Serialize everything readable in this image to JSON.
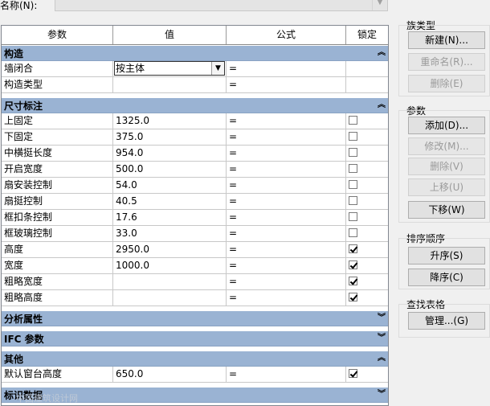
{
  "name_label": "名称(N):",
  "grid": {
    "columns": [
      "参数",
      "值",
      "公式",
      "锁定"
    ],
    "groups": [
      {
        "title": "构造",
        "expanded": true,
        "rows": [
          {
            "param": "墙闭合",
            "value": "按主体",
            "formula": "=",
            "locked": null,
            "editor": "dropdown"
          },
          {
            "param": "构造类型",
            "value": "",
            "formula": "=",
            "locked": null
          }
        ]
      },
      {
        "title": "尺寸标注",
        "expanded": true,
        "rows": [
          {
            "param": "上固定",
            "value": "1325.0",
            "formula": "=",
            "locked": false
          },
          {
            "param": "下固定",
            "value": "375.0",
            "formula": "=",
            "locked": false
          },
          {
            "param": "中横挺长度",
            "value": "954.0",
            "formula": "=",
            "locked": false
          },
          {
            "param": "开启宽度",
            "value": "500.0",
            "formula": "=",
            "locked": false
          },
          {
            "param": "扇安装控制",
            "value": "54.0",
            "formula": "=",
            "locked": false
          },
          {
            "param": "扇挺控制",
            "value": "40.5",
            "formula": "=",
            "locked": false
          },
          {
            "param": "框扣条控制",
            "value": "17.6",
            "formula": "=",
            "locked": false
          },
          {
            "param": "框玻璃控制",
            "value": "33.0",
            "formula": "=",
            "locked": false
          },
          {
            "param": "高度",
            "value": "2950.0",
            "formula": "=",
            "locked": true
          },
          {
            "param": "宽度",
            "value": "1000.0",
            "formula": "=",
            "locked": true
          },
          {
            "param": "粗略宽度",
            "value": "",
            "formula": "=",
            "locked": true
          },
          {
            "param": "粗略高度",
            "value": "",
            "formula": "=",
            "locked": true
          }
        ]
      },
      {
        "title": "分析属性",
        "expanded": false,
        "rows": []
      },
      {
        "title": "IFC 参数",
        "expanded": false,
        "rows": []
      },
      {
        "title": "其他",
        "expanded": true,
        "rows": [
          {
            "param": "默认窗台高度",
            "value": "650.0",
            "formula": "=",
            "locked": true
          }
        ]
      },
      {
        "title": "标识数据",
        "expanded": false,
        "rows": []
      }
    ]
  },
  "family_types": {
    "title": "族类型",
    "buttons": [
      {
        "label": "新建(N)...",
        "enabled": true
      },
      {
        "label": "重命名(R)...",
        "enabled": false
      },
      {
        "label": "删除(E)",
        "enabled": false
      }
    ]
  },
  "parameters": {
    "title": "参数",
    "buttons": [
      {
        "label": "添加(D)...",
        "enabled": true
      },
      {
        "label": "修改(M)...",
        "enabled": false
      },
      {
        "label": "删除(V)",
        "enabled": false
      },
      {
        "label": "上移(U)",
        "enabled": false
      },
      {
        "label": "下移(W)",
        "enabled": true
      }
    ]
  },
  "sort_order": {
    "title": "排序顺序",
    "buttons": [
      {
        "label": "升序(S)",
        "enabled": true
      },
      {
        "label": "降序(C)",
        "enabled": true
      }
    ]
  },
  "lookup_tables": {
    "title": "查找表格",
    "buttons": [
      {
        "label": "管理...(G)",
        "enabled": true
      }
    ]
  },
  "watermark": "中国建筑设计网"
}
